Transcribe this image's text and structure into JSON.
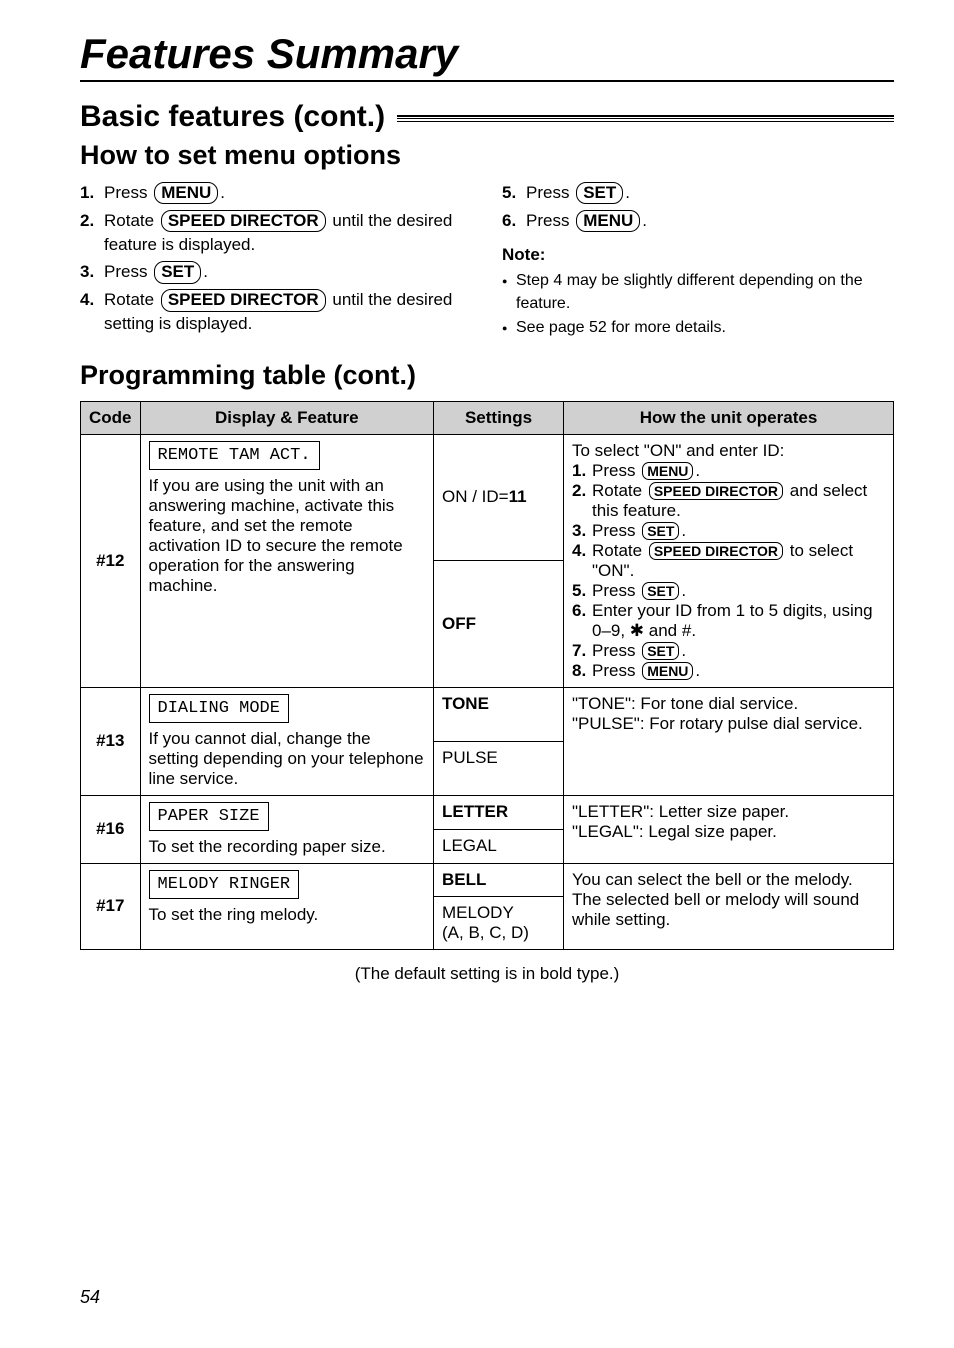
{
  "title": "Features Summary",
  "section_title": "Basic features (cont.)",
  "subsection": "How to set menu options",
  "steps_left": [
    {
      "n": "1.",
      "pre": "Press ",
      "key": "MENU",
      "post": "."
    },
    {
      "n": "2.",
      "pre": "Rotate ",
      "key": "SPEED DIRECTOR",
      "post": " until the desired feature is displayed."
    },
    {
      "n": "3.",
      "pre": "Press ",
      "key": "SET",
      "post": "."
    },
    {
      "n": "4.",
      "pre": "Rotate ",
      "key": "SPEED DIRECTOR",
      "post": " until the desired setting is displayed."
    }
  ],
  "steps_right": [
    {
      "n": "5.",
      "pre": "Press ",
      "key": "SET",
      "post": "."
    },
    {
      "n": "6.",
      "pre": "Press ",
      "key": "MENU",
      "post": "."
    }
  ],
  "note_head": "Note:",
  "notes": [
    "Step 4 may be slightly different depending on the feature.",
    "See page 52 for more details."
  ],
  "prog_title": "Programming table (cont.)",
  "headers": {
    "code": "Code",
    "feat": "Display & Feature",
    "set": "Settings",
    "op": "How the unit operates"
  },
  "rows": {
    "r12": {
      "code": "#12",
      "display": "REMOTE TAM ACT.",
      "feat": "If you are using the unit with an answering machine, activate this feature, and set the remote activation ID to secure the remote operation for the answering machine.",
      "set1_pre": "ON / ID=",
      "set1_bold": "11",
      "set2": "OFF",
      "op_intro": "To select \"ON\" and enter ID:",
      "op": [
        {
          "n": "1.",
          "t": "Press ",
          "key": "MENU",
          "post": "."
        },
        {
          "n": "2.",
          "t": "Rotate ",
          "key": "SPEED DIRECTOR",
          "post": " and select this feature."
        },
        {
          "n": "3.",
          "t": "Press ",
          "key": "SET",
          "post": "."
        },
        {
          "n": "4.",
          "t": "Rotate ",
          "key": "SPEED DIRECTOR",
          "post": " to select \"ON\"."
        },
        {
          "n": "5.",
          "t": "Press ",
          "key": "SET",
          "post": "."
        },
        {
          "n": "6.",
          "t": "Enter your ID from 1 to 5 digits, using 0–9, ✱ and #.",
          "key": null,
          "post": ""
        },
        {
          "n": "7.",
          "t": "Press ",
          "key": "SET",
          "post": "."
        },
        {
          "n": "8.",
          "t": "Press ",
          "key": "MENU",
          "post": "."
        }
      ]
    },
    "r13": {
      "code": "#13",
      "display": "DIALING MODE",
      "feat": "If you cannot dial, change the setting depending on your telephone line service.",
      "set1": "TONE",
      "set2": "PULSE",
      "op": "\"TONE\": For tone dial service.\n\"PULSE\": For rotary pulse dial service."
    },
    "r16": {
      "code": "#16",
      "display": "PAPER SIZE",
      "feat": "To set the recording paper size.",
      "set1": "LETTER",
      "set2": "LEGAL",
      "op": "\"LETTER\": Letter size paper.\n\"LEGAL\": Legal size paper."
    },
    "r17": {
      "code": "#17",
      "display": "MELODY RINGER",
      "feat": "To set the ring melody.",
      "set1": "BELL",
      "set2": "MELODY\n(A, B, C, D)",
      "op": "You can select the bell or the melody. The selected bell or melody will sound while setting."
    }
  },
  "default_note": "(The default setting is in bold type.)",
  "page_num": "54"
}
